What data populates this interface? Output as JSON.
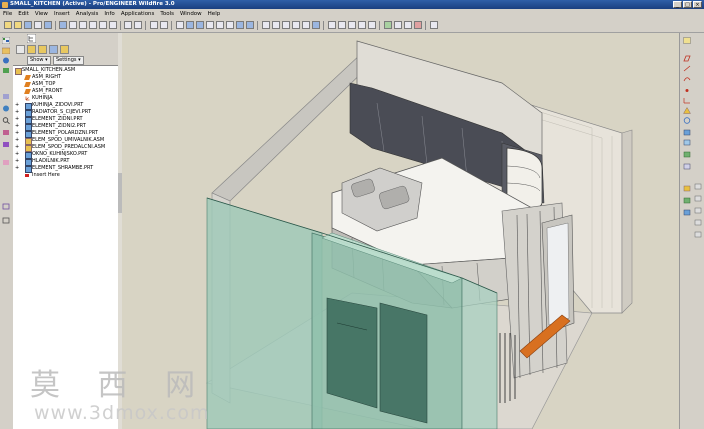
{
  "window": {
    "title": "SMALL_KITCHEN (Active) - Pro/ENGINEER Wildfire 3.0",
    "controls": [
      "_",
      "□",
      "×"
    ]
  },
  "menu": [
    "File",
    "Edit",
    "View",
    "Insert",
    "Analysis",
    "Info",
    "Applications",
    "Tools",
    "Window",
    "Help"
  ],
  "navigator": {
    "show_label": "Show ▾",
    "settings_label": "Settings ▾",
    "tree": [
      {
        "label": "SMALL_KITCHEN.ASM",
        "icon": "assembly-icon",
        "level": 0
      },
      {
        "label": "ASM_RIGHT",
        "icon": "datum-plane-icon",
        "level": 1
      },
      {
        "label": "ASM_TOP",
        "icon": "datum-plane-icon",
        "level": 1
      },
      {
        "label": "ASM_FRONT",
        "icon": "datum-plane-icon",
        "level": 1
      },
      {
        "label": "KUHINJA",
        "icon": "coordinate-system-icon",
        "level": 1
      },
      {
        "label": "KUHINJA_ZIDOVI.PRT",
        "icon": "part-icon",
        "level": 1
      },
      {
        "label": "RADIATOR_S_CIJEVI.PRT",
        "icon": "part-icon",
        "level": 1
      },
      {
        "label": "ELEMENT_ZIDNI.PRT",
        "icon": "part-icon",
        "level": 1
      },
      {
        "label": "ELEMENT_ZIDNI2.PRT",
        "icon": "part-icon",
        "level": 1
      },
      {
        "label": "ELEMENT_POLARDZNI.PRT",
        "icon": "part-icon",
        "level": 1
      },
      {
        "label": "ELEM_SPOD_UMIVALNIK.ASM",
        "icon": "assembly-icon",
        "level": 1
      },
      {
        "label": "ELEM_SPOD_PREDALCNI.ASM",
        "icon": "assembly-icon",
        "level": 1
      },
      {
        "label": "OKNO_KUHINJSKO.PRT",
        "icon": "part-icon",
        "level": 1
      },
      {
        "label": "HLADILNIK.PRT",
        "icon": "part-icon",
        "level": 1
      },
      {
        "label": "ELEMENT_SHRAMBE.PRT",
        "icon": "part-icon",
        "level": 1
      },
      {
        "label": "Insert Here",
        "icon": "insert-here-icon",
        "level": 1
      }
    ]
  },
  "watermark": {
    "chinese": "莫 西 网",
    "url": "www.3dmox.com"
  },
  "colors": {
    "titlebar": "#1f4a90",
    "chrome": "#d4d0c8",
    "viewport_bg": "#d8d4c4",
    "wall_fill": "#e8e4dc",
    "glass_teal": "#9fc9b8",
    "cabinet_dark": "#4a4c55",
    "accent_orange": "#d87020"
  }
}
